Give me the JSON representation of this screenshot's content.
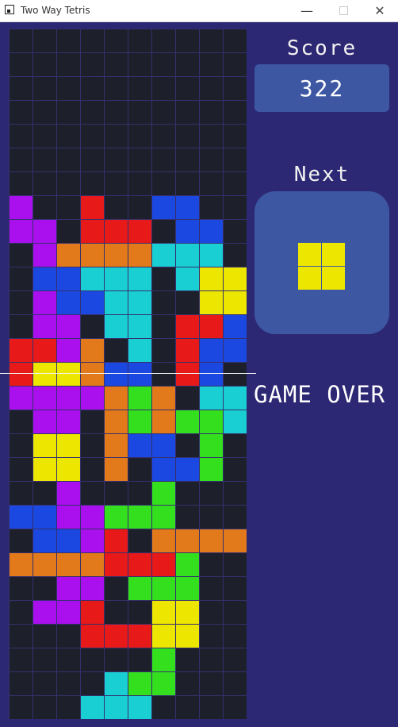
{
  "window": {
    "title": "Two Way Tetris"
  },
  "sidebar": {
    "score_label": "Score",
    "score_value": "322",
    "next_label": "Next"
  },
  "status": {
    "game_over": "GAME OVER"
  },
  "colors": {
    "P": "#aa0fee",
    "R": "#e81919",
    "B": "#1b48e0",
    "O": "#e27a1b",
    "C": "#19cfd4",
    "Y": "#ece600",
    "G": "#34df1e"
  },
  "next_piece": {
    "name": "O",
    "color": "#ece600"
  },
  "board": [
    "..........",
    "..........",
    "..........",
    "..........",
    "..........",
    "..........",
    "..........",
    "P..R..BB..",
    "PP.RRR.BB.",
    ".POOOOCCC.",
    ".BBCCC.CYY",
    ".PBBCC..YY",
    ".PP.CC.RRB",
    "RRPO.C.RBB",
    "RYYOBB.RB.",
    "PPPPOGO.CC",
    ".PP.OGOGGC",
    ".YY.OBB.G.",
    ".YY.O.BBG.",
    "..P...G...",
    "BBPPGGG...",
    ".BBPR.OOOO",
    "OOOORRRG..",
    "..PP.GGG..",
    ".PPR..YY..",
    "...RRRYY..",
    "......G...",
    "....CGG...",
    "...CCC...."
  ]
}
